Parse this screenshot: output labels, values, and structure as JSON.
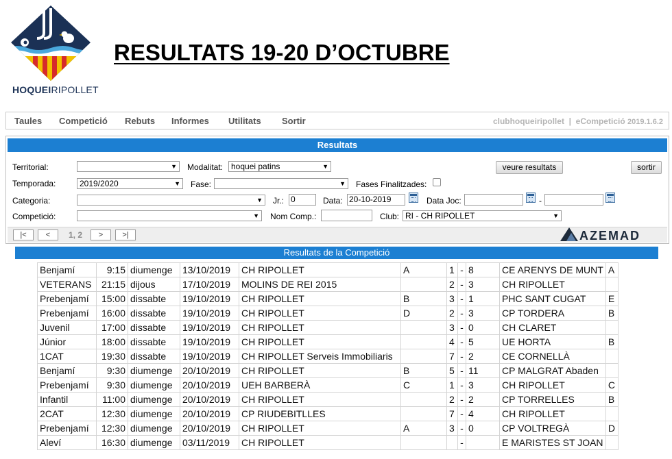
{
  "header": {
    "logo_text_bold": "HOQUEI",
    "logo_text_light": "RIPOLLET",
    "title": "RESULTATS 19-20 D’OCTUBRE"
  },
  "menu": {
    "items": [
      "Taules",
      "Competició",
      "Rebuts",
      "Informes",
      "Utilitats",
      "Sortir"
    ],
    "right_user": "clubhoqueiripollet",
    "right_sep": "|",
    "right_app": "eCompetició",
    "right_version": "2019.1.6.2"
  },
  "panel": {
    "title": "Resultats",
    "labels": {
      "territorial": "Territorial:",
      "modalitat": "Modalitat:",
      "temporada": "Temporada:",
      "fase": "Fase:",
      "fases_finalitzades": "Fases Finalitzades:",
      "categoria": "Categoria:",
      "jr": "Jr.:",
      "data": "Data:",
      "data_joc": "Data Joc:",
      "data_joc_sep": "-",
      "competicio": "Competició:",
      "nom_comp": "Nom Comp.:",
      "club": "Club:"
    },
    "values": {
      "territorial": "",
      "modalitat": "hoquei patins",
      "temporada": "2019/2020",
      "fase": "",
      "categoria": "",
      "jr": "0",
      "data": "20-10-2019",
      "data_joc_from": "",
      "data_joc_to": "",
      "competicio": "",
      "nom_comp": "",
      "club": "RI - CH RIPOLLET"
    },
    "buttons": {
      "veure": "veure resultats",
      "sortir": "sortir"
    },
    "pager": {
      "first": "|<",
      "prev": "<",
      "info": "1, 2",
      "next": ">",
      "last": ">|"
    },
    "brand": "AZEMAD",
    "brand_color": "#1d2a3a"
  },
  "results": {
    "title": "Resultats de la Competició",
    "rows": [
      [
        "Benjamí",
        "9:15",
        "diumenge",
        "13/10/2019",
        "CH RIPOLLET",
        "A",
        "1",
        "-",
        "8",
        "CE ARENYS DE MUNT",
        "A"
      ],
      [
        "VETERANS",
        "21:15",
        "dijous",
        "17/10/2019",
        "MOLINS DE REI 2015",
        "",
        "2",
        "-",
        "3",
        "CH RIPOLLET",
        ""
      ],
      [
        "Prebenjamí",
        "15:00",
        "dissabte",
        "19/10/2019",
        "CH RIPOLLET",
        "B",
        "3",
        "-",
        "1",
        "PHC SANT CUGAT",
        "E"
      ],
      [
        "Prebenjamí",
        "16:00",
        "dissabte",
        "19/10/2019",
        "CH RIPOLLET",
        "D",
        "2",
        "-",
        "3",
        "CP TORDERA",
        "B"
      ],
      [
        "Juvenil",
        "17:00",
        "dissabte",
        "19/10/2019",
        "CH RIPOLLET",
        "",
        "3",
        "-",
        "0",
        "CH CLARET",
        ""
      ],
      [
        "Júnior",
        "18:00",
        "dissabte",
        "19/10/2019",
        "CH RIPOLLET",
        "",
        "4",
        "-",
        "5",
        "UE HORTA",
        "B"
      ],
      [
        "1CAT",
        "19:30",
        "dissabte",
        "19/10/2019",
        "CH RIPOLLET Serveis Immobiliaris",
        "",
        "7",
        "-",
        "2",
        "CE CORNELLÀ",
        ""
      ],
      [
        "Benjamí",
        "9:30",
        "diumenge",
        "20/10/2019",
        "CH RIPOLLET",
        "B",
        "5",
        "-",
        "11",
        "CP MALGRAT Abaden",
        ""
      ],
      [
        "Prebenjamí",
        "9:30",
        "diumenge",
        "20/10/2019",
        "UEH BARBERÀ",
        "C",
        "1",
        "-",
        "3",
        "CH RIPOLLET",
        "C"
      ],
      [
        "Infantil",
        "11:00",
        "diumenge",
        "20/10/2019",
        "CH RIPOLLET",
        "",
        "2",
        "-",
        "2",
        "CP TORRELLES",
        "B"
      ],
      [
        "2CAT",
        "12:30",
        "diumenge",
        "20/10/2019",
        "CP RIUDEBITLLES",
        "",
        "7",
        "-",
        "4",
        "CH RIPOLLET",
        ""
      ],
      [
        "Prebenjamí",
        "12:30",
        "diumenge",
        "20/10/2019",
        "CH RIPOLLET",
        "A",
        "3",
        "-",
        "0",
        "CP VOLTREGÀ",
        "D"
      ],
      [
        "Aleví",
        "16:30",
        "diumenge",
        "03/11/2019",
        "CH RIPOLLET",
        "",
        "",
        "-",
        "",
        "E MARISTES ST JOAN",
        ""
      ]
    ]
  },
  "colors": {
    "header_blue": "#1c7fd2",
    "logo_navy": "#1b3155",
    "logo_red": "#d62b2b",
    "logo_yellow": "#f2c200"
  }
}
